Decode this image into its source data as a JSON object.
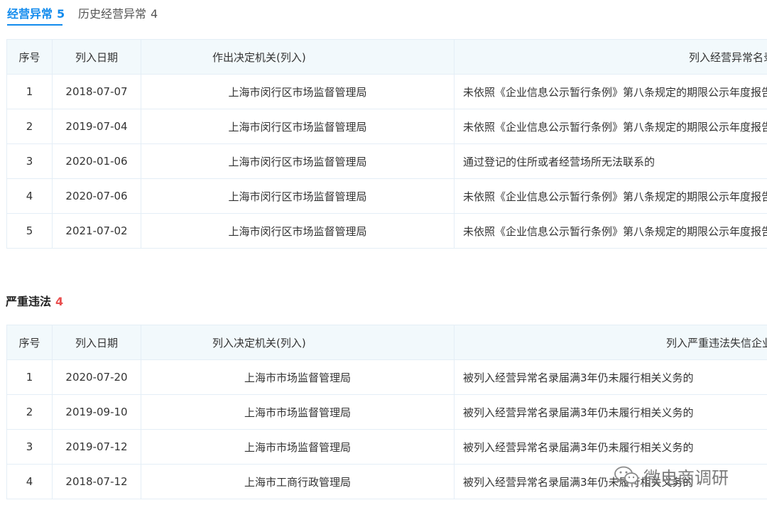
{
  "tabs": {
    "active": {
      "label": "经营异常",
      "count": "5"
    },
    "inactive": {
      "label": "历史经营异常",
      "count": "4"
    }
  },
  "table1": {
    "headers": {
      "idx": "序号",
      "date": "列入日期",
      "org": "作出决定机关(列入)",
      "reason": "列入经营异常名录原因"
    },
    "rows": [
      {
        "idx": "1",
        "date": "2018-07-07",
        "org": "上海市闵行区市场监督管理局",
        "reason": "未依照《企业信息公示暂行条例》第八条规定的期限公示年度报告的"
      },
      {
        "idx": "2",
        "date": "2019-07-04",
        "org": "上海市闵行区市场监督管理局",
        "reason": "未依照《企业信息公示暂行条例》第八条规定的期限公示年度报告的"
      },
      {
        "idx": "3",
        "date": "2020-01-06",
        "org": "上海市闵行区市场监督管理局",
        "reason": "通过登记的住所或者经营场所无法联系的"
      },
      {
        "idx": "4",
        "date": "2020-07-06",
        "org": "上海市闵行区市场监督管理局",
        "reason": "未依照《企业信息公示暂行条例》第八条规定的期限公示年度报告的"
      },
      {
        "idx": "5",
        "date": "2021-07-02",
        "org": "上海市闵行区市场监督管理局",
        "reason": "未依照《企业信息公示暂行条例》第八条规定的期限公示年度报告的"
      }
    ]
  },
  "section2": {
    "title": "严重违法",
    "count": "4"
  },
  "table2": {
    "headers": {
      "idx": "序号",
      "date": "列入日期",
      "org": "列入决定机关(列入)",
      "reason": "列入严重违法失信企业名单原因"
    },
    "rows": [
      {
        "idx": "1",
        "date": "2020-07-20",
        "org": "上海市市场监督管理局",
        "reason": "被列入经营异常名录届满3年仍未履行相关义务的"
      },
      {
        "idx": "2",
        "date": "2019-09-10",
        "org": "上海市市场监督管理局",
        "reason": "被列入经营异常名录届满3年仍未履行相关义务的"
      },
      {
        "idx": "3",
        "date": "2019-07-12",
        "org": "上海市市场监督管理局",
        "reason": "被列入经营异常名录届满3年仍未履行相关义务的"
      },
      {
        "idx": "4",
        "date": "2018-07-12",
        "org": "上海市工商行政管理局",
        "reason": "被列入经营异常名录届满3年仍未履行相关义务的"
      }
    ]
  },
  "watermark": {
    "text": "微电商调研",
    "icon": "wechat-icon"
  },
  "colors": {
    "accent": "#128bed",
    "count_red": "#e94e4e",
    "header_bg": "#f2f9fc",
    "border": "#e4eef6"
  }
}
